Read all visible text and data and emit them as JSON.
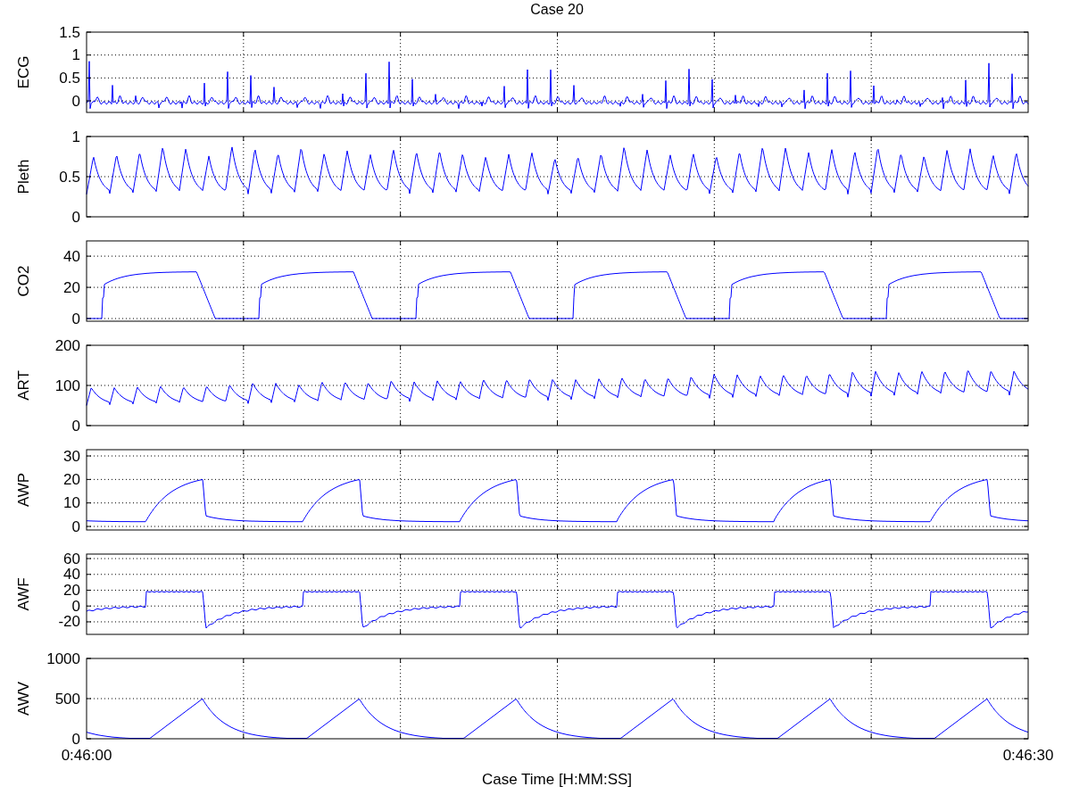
{
  "title": "Case 20",
  "panels": [
    {
      "kind": "ecg",
      "ylabel": "ECG",
      "yticks": [
        "1.5",
        "1",
        "0.5",
        "0"
      ]
    },
    {
      "kind": "pleth",
      "ylabel": "Pleth",
      "yticks": [
        "1",
        "0.5",
        "0"
      ]
    },
    {
      "kind": "co2",
      "ylabel": "CO2",
      "yticks": [
        "40",
        "20",
        "0"
      ]
    },
    {
      "kind": "art",
      "ylabel": "ART",
      "yticks": [
        "200",
        "100",
        "0"
      ]
    },
    {
      "kind": "awp",
      "ylabel": "AWP",
      "yticks": [
        "30",
        "20",
        "10",
        "0"
      ]
    },
    {
      "kind": "awf",
      "ylabel": "AWF",
      "yticks": [
        "60",
        "40",
        "20",
        "0",
        "-20"
      ]
    },
    {
      "kind": "awv",
      "ylabel": "AWV",
      "yticks": [
        "1000",
        "500",
        "0"
      ]
    }
  ],
  "xticks": [
    "0:46:00",
    "0:46:30"
  ],
  "xlabel": "Case Time [H:MM:SS]"
}
